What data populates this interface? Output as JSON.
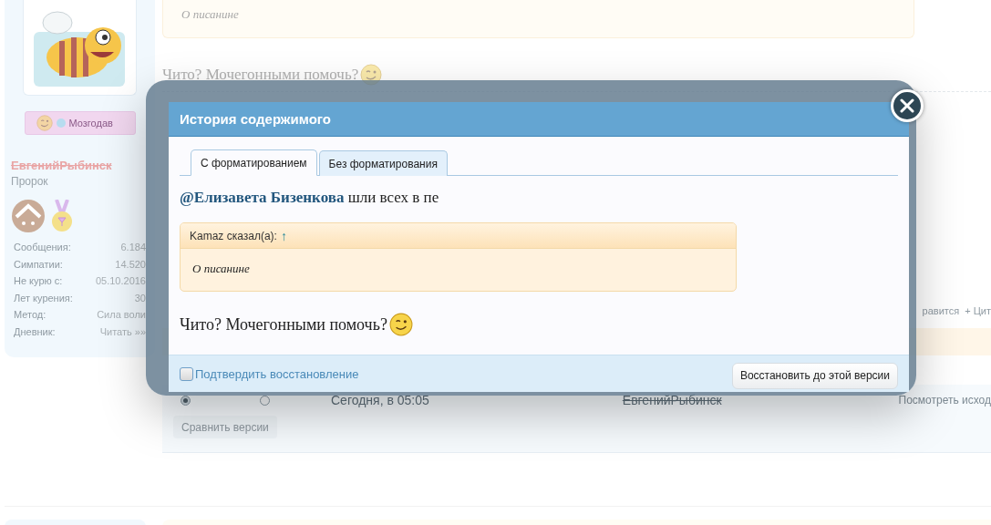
{
  "sidebar": {
    "badge": "Мозгодав",
    "username": "ЕвгенийРыбинск",
    "banned": true,
    "user_title": "Пророк",
    "stats": [
      {
        "label": "Сообщения:",
        "value": "6.184"
      },
      {
        "label": "Симпатии:",
        "value": "14.520"
      },
      {
        "label": "Не курю с:",
        "value": "05.10.2016"
      },
      {
        "label": "Лет курения:",
        "value": "30"
      },
      {
        "label": "Метод:",
        "value": "Сила воли"
      },
      {
        "label": "Дневник:",
        "value": "Читать »»"
      }
    ]
  },
  "post": {
    "quote_text": "О писанине",
    "message": "Чито? Мочегонными помочь?"
  },
  "post_actions": [
    "равится",
    "+ Цит"
  ],
  "history": {
    "rows": [
      {
        "radios": [
          {
            "selected": true
          },
          {
            "selected": false
          }
        ],
        "date": "Сегодня, в 05:05",
        "author": "ЕвгенийРыбинск",
        "author_banned": true,
        "action": "Посмотреть исход"
      }
    ],
    "compare_button": "Сравнить версии"
  },
  "modal": {
    "title": "История содержимого",
    "tabs": [
      {
        "label": "С форматированием",
        "selected": true
      },
      {
        "label": "Без форматирования",
        "selected": false
      }
    ],
    "mention": "@Елизавета Бизенкова",
    "text": "шли всех в пе",
    "quote": {
      "author": "Kamaz сказал(а):",
      "link": "↑",
      "text": "О писанине"
    },
    "message": "Чито? Мочегонными помочь?",
    "confirm": {
      "label": "Подтвердить восстановление",
      "checked": false
    },
    "restore_button": "Восстановить до этой версии"
  }
}
